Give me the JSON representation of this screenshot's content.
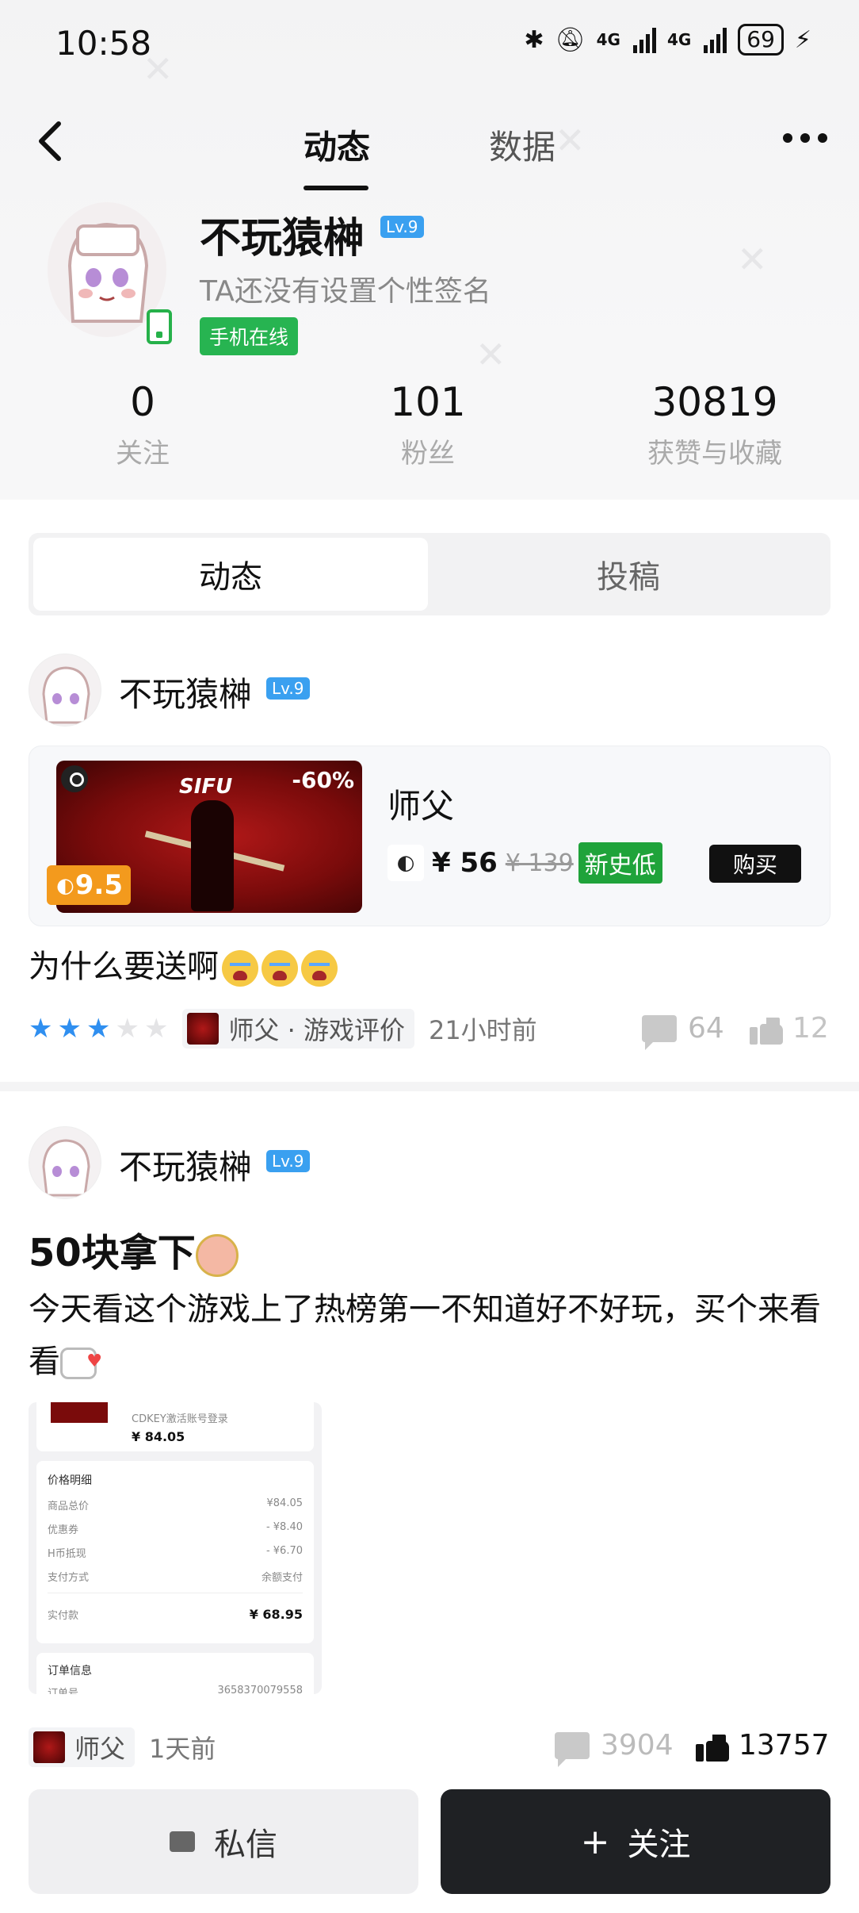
{
  "status_bar": {
    "time": "10:58",
    "network1": "4G",
    "network2": "4G",
    "battery": "69"
  },
  "nav": {
    "tab_active": "动态",
    "tab_other": "数据"
  },
  "profile": {
    "name": "不玩猿榊",
    "level": "Lv.9",
    "signature": "TA还没有设置个性签名",
    "online": "手机在线",
    "stats": [
      {
        "value": "0",
        "label": "关注"
      },
      {
        "value": "101",
        "label": "粉丝"
      },
      {
        "value": "30819",
        "label": "获赞与收藏"
      }
    ]
  },
  "segments": {
    "active": "动态",
    "inactive": "投稿"
  },
  "post1": {
    "author": "不玩猿榊",
    "level": "Lv.9",
    "game": {
      "title": "师父",
      "cover_title": "SIFU",
      "discount": "-60%",
      "score": "9.5",
      "price_now": "¥ 56",
      "price_old": "¥ 139",
      "low_badge": "新史低",
      "buy_label": "购买"
    },
    "text": "为什么要送啊",
    "rating_stars": 3,
    "rating_max": 5,
    "tag": "师父 · 游戏评价",
    "time": "21小时前",
    "comments": "64",
    "likes": "12"
  },
  "post2": {
    "author": "不玩猿榊",
    "level": "Lv.9",
    "headline": "50块拿下",
    "body": "今天看这个游戏上了热榜第一不知道好不好玩，买个来看看",
    "receipt": {
      "subtitle": "CDKEY激活账号登录",
      "price_top": "¥ 84.05",
      "detail_head": "价格明细",
      "rows": [
        {
          "label": "商品总价",
          "value": "¥84.05"
        },
        {
          "label": "优惠券",
          "value": "- ¥8.40"
        },
        {
          "label": "H币抵现",
          "value": "- ¥6.70"
        },
        {
          "label": "支付方式",
          "value": "余额支付"
        }
      ],
      "paid_label": "实付款",
      "paid_value": "¥ 68.95",
      "order_head": "订单信息",
      "order_label": "订单号",
      "order_value": "3658370079558"
    },
    "tag": "师父",
    "time": "1天前",
    "comments": "3904",
    "likes": "13757"
  },
  "bottom": {
    "message": "私信",
    "follow": "关注"
  },
  "colors": {
    "accent_green": "#27b451",
    "level_blue": "#3aa0f0",
    "star_blue": "#2f8ff0",
    "price_orange": "#f39a1d"
  }
}
